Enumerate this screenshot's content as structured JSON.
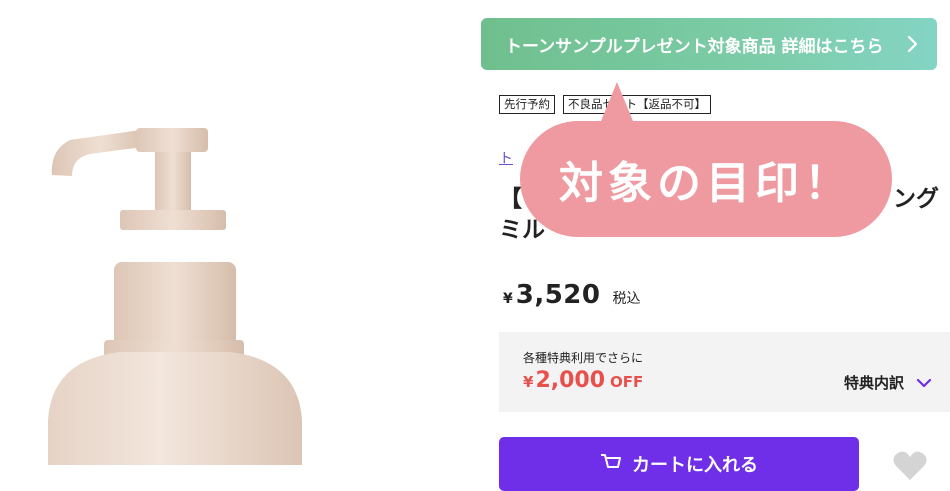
{
  "promo_banner": {
    "text": "トーンサンプルプレゼント対象商品 詳細はこちら",
    "icon": "chevron-right-icon"
  },
  "tags": [
    "先行予約",
    "不良品セット【返品不可】"
  ],
  "brand_link": "ト",
  "product_title": {
    "line1_start": "【",
    "line1_end": "ング",
    "line2": "ミル"
  },
  "price": {
    "currency": "¥",
    "amount": "3,520",
    "tax_label": "税込"
  },
  "benefit": {
    "caption": "各種特典利用でさらに",
    "currency": "¥",
    "amount": "2,000",
    "off_label": "OFF",
    "toggle_label": "特典内訳",
    "toggle_icon": "chevron-down-icon"
  },
  "cart_button": {
    "label": "カートに入れる",
    "icon": "cart-icon"
  },
  "callout": {
    "text": "対象の目印！"
  },
  "colors": {
    "promo_green": "#6fbf8e",
    "accent_purple": "#6f2ee8",
    "off_red": "#e8504d",
    "callout_pink": "#ef9aa0"
  }
}
